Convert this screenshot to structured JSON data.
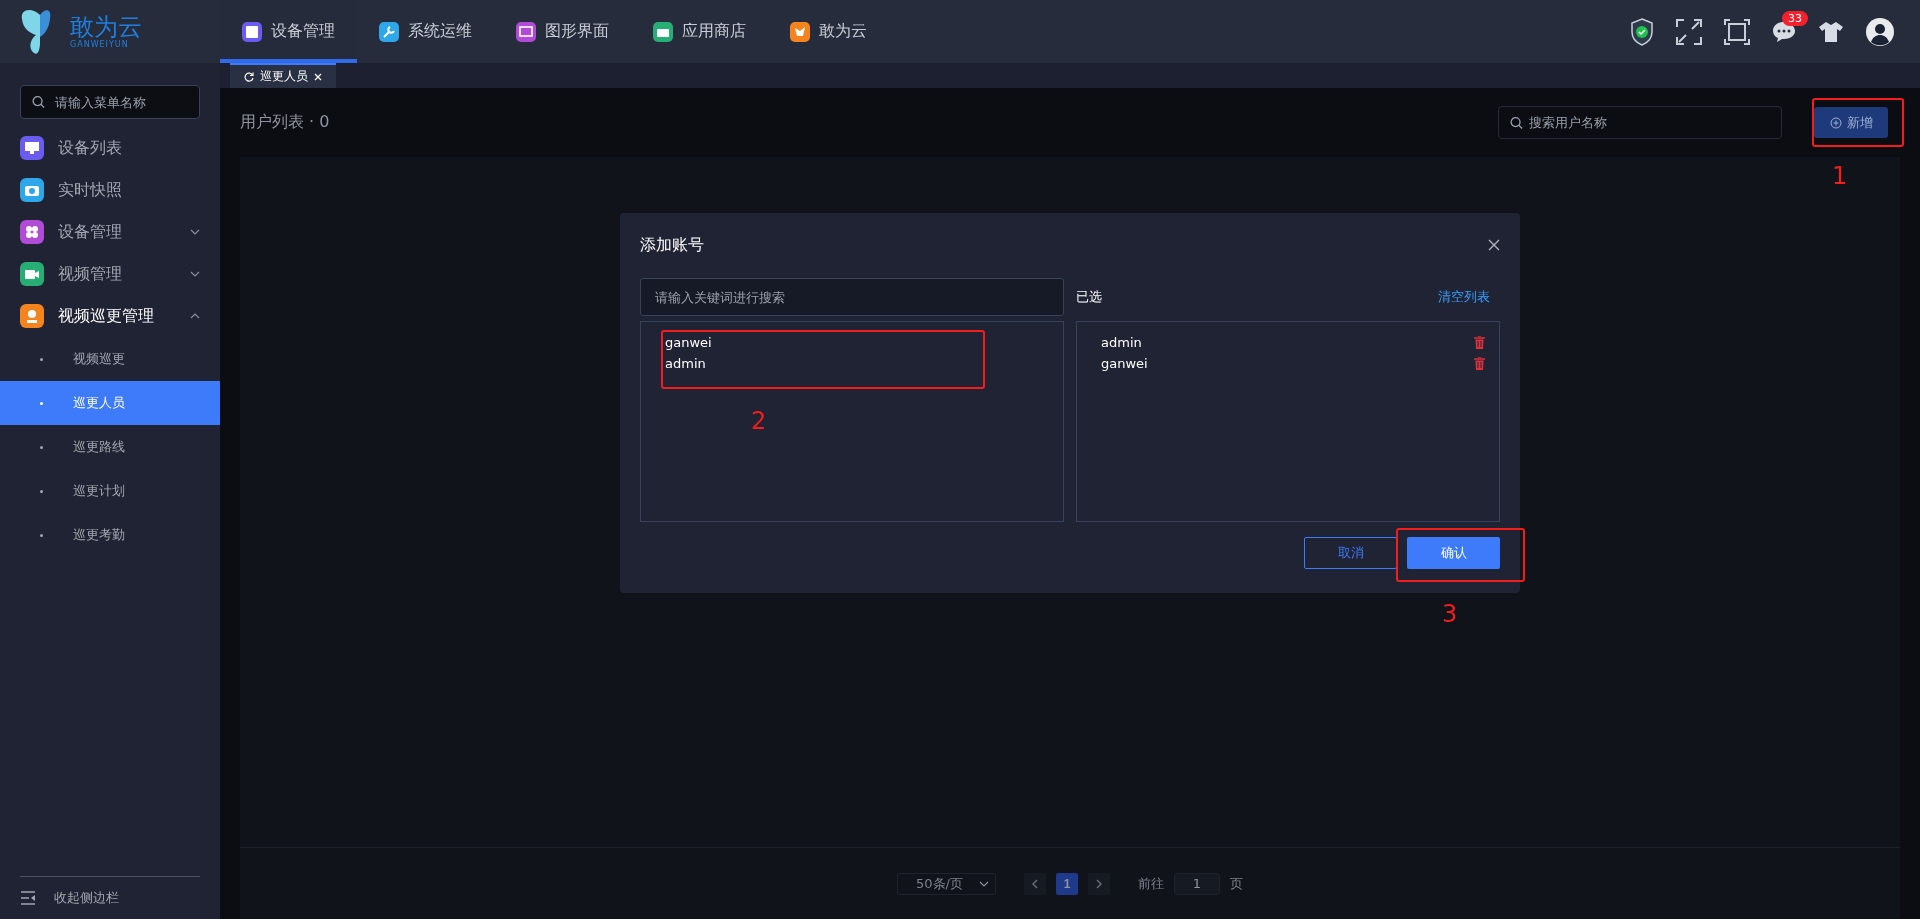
{
  "logo": {
    "name": "敢为云",
    "subtitle": "GANWEIYUN"
  },
  "top_nav": [
    {
      "label": "设备管理",
      "selected": true,
      "color": "#6a5cf0"
    },
    {
      "label": "系统运维",
      "selected": false,
      "color": "#2ea7e8"
    },
    {
      "label": "图形界面",
      "selected": false,
      "color": "#b04bd6"
    },
    {
      "label": "应用商店",
      "selected": false,
      "color": "#27ae74"
    },
    {
      "label": "敢为云",
      "selected": false,
      "color": "#f5841f"
    }
  ],
  "header_icons": {
    "message_badge": "33"
  },
  "sidebar": {
    "search": {
      "placeholder": "请输入菜单名称"
    },
    "items": [
      {
        "label": "设备列表",
        "color": "#6a5cf0",
        "expanded": false,
        "has_children": false
      },
      {
        "label": "实时快照",
        "color": "#2ea7e8",
        "expanded": false,
        "has_children": false
      },
      {
        "label": "设备管理",
        "color": "#b04bd6",
        "expanded": false,
        "has_children": true
      },
      {
        "label": "视频管理",
        "color": "#27ae74",
        "expanded": false,
        "has_children": true
      },
      {
        "label": "视频巡更管理",
        "color": "#f5841f",
        "expanded": true,
        "has_children": true,
        "children": [
          {
            "label": "视频巡更",
            "selected": false
          },
          {
            "label": "巡更人员",
            "selected": true
          },
          {
            "label": "巡更路线",
            "selected": false
          },
          {
            "label": "巡更计划",
            "selected": false
          },
          {
            "label": "巡更考勤",
            "selected": false
          }
        ]
      }
    ],
    "collapse": "收起侧边栏"
  },
  "page_tabs": [
    {
      "label": "巡更人员",
      "selected": true
    }
  ],
  "content": {
    "title": "用户列表 · 0",
    "search": {
      "placeholder": "搜索用户名称"
    },
    "add_button": "新增",
    "pagination": {
      "page_size": "50条/页",
      "pages": [
        {
          "label": "1",
          "selected": true
        }
      ],
      "goto_label": "前往",
      "goto_value": "1",
      "page_unit": "页"
    }
  },
  "dialog": {
    "title": "添加账号",
    "search": {
      "placeholder": "请输入关键词进行搜索"
    },
    "available": [
      "ganwei",
      "admin"
    ],
    "selected_title": "已选",
    "clear_link": "清空列表",
    "selected": [
      "admin",
      "ganwei"
    ],
    "buttons": {
      "cancel": "取消",
      "confirm": "确认"
    }
  },
  "annotations": [
    {
      "label": "1"
    },
    {
      "label": "2"
    },
    {
      "label": "3"
    }
  ]
}
